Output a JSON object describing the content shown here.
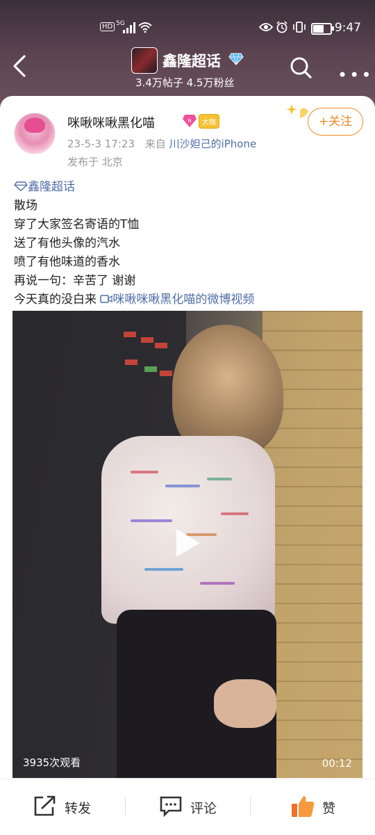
{
  "status_bar": {
    "signal": "5G",
    "hd": "HD",
    "time": "9:47"
  },
  "header": {
    "title": "鑫隆超话",
    "stats": "3.4万帖子 4.5万粉丝"
  },
  "post": {
    "username": "咪啾咪啾黑化喵",
    "fan_badge": "大咖",
    "date": "23-5-3 17:23",
    "source_prefix": "来自",
    "source": "川沙妲己的iPhone",
    "location": "发布于 北京",
    "follow_label": "+关注",
    "topic_tag": "鑫隆超话",
    "lines": [
      "散场",
      "穿了大家签名寄语的T恤",
      "送了有他头像的汽水",
      "喷了有他味道的香水",
      "再说一句：辛苦了 谢谢",
      "今天真的没白来"
    ],
    "video_link": "咪啾咪啾黑化喵的微博视频",
    "video": {
      "views": "3935次观看",
      "duration": "00:12"
    }
  },
  "actions": {
    "repost": "转发",
    "comment": "评论",
    "like": "赞"
  },
  "colors": {
    "accent": "#f08a26",
    "link": "#4f6da8"
  }
}
